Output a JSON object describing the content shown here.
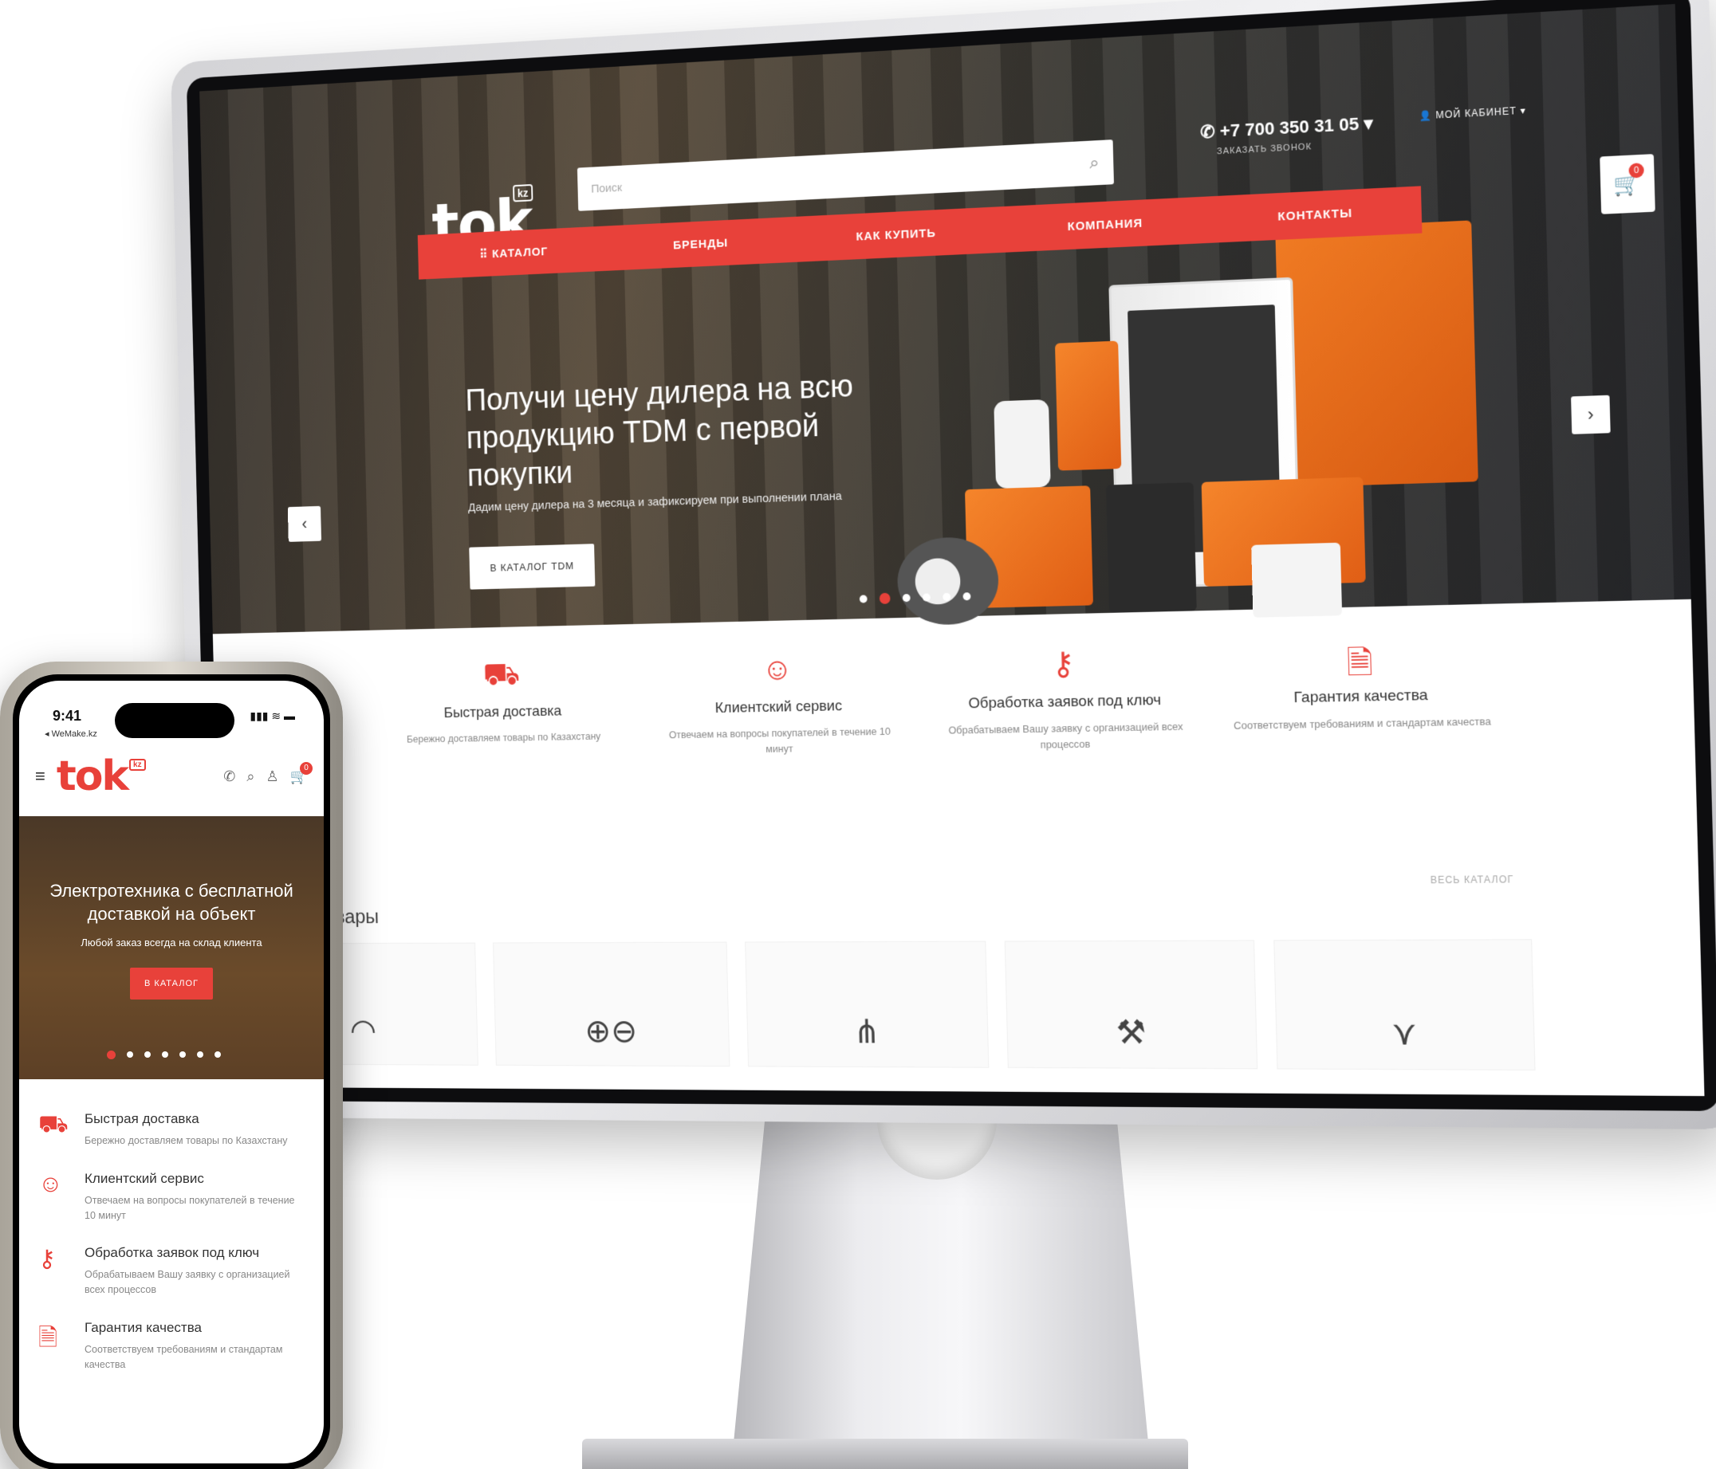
{
  "desktop": {
    "logo": "tok",
    "logo_badge": "kz",
    "search": {
      "placeholder": "Поиск"
    },
    "phone": "+7 700 350 31 05",
    "callback": "ЗАКАЗАТЬ ЗВОНОК",
    "cabinet": "МОЙ КАБИНЕТ",
    "cart_count": "0",
    "nav": [
      "КАТАЛОГ",
      "БРЕНДЫ",
      "КАК КУПИТЬ",
      "КОМПАНИЯ",
      "КОНТАКТЫ"
    ],
    "hero": {
      "title": "Получи цену дилера на всю продукцию TDM с первой покупки",
      "subtitle": "Дадим цену дилера на 3 месяца и зафиксируем при выполнении плана",
      "cta": "В КАТАЛОГ TDM"
    },
    "features": [
      {
        "icon": "delivery-truck-icon",
        "title": "Быстрая доставка",
        "desc": "Бережно доставляем товары по Казахстану"
      },
      {
        "icon": "support-agent-icon",
        "title": "Клиентский сервис",
        "desc": "Отвечаем на вопросы покупателей в течение 10 минут"
      },
      {
        "icon": "keys-icon",
        "title": "Обработка заявок под ключ",
        "desc": "Обрабатываем Вашу заявку с организацией всех процессов"
      },
      {
        "icon": "certificate-icon",
        "title": "Гарантия качества",
        "desc": "Соответствуем требованиям и стандартам качества"
      }
    ],
    "goods_title": "Наши товары",
    "all_catalog": "ВЕСЬ КАТАЛОГ"
  },
  "mobile": {
    "time": "9:41",
    "back": "◂ WeMake.kz",
    "logo": "tok",
    "logo_badge": "kz",
    "cart_count": "0",
    "hero": {
      "title": "Электротехника с бесплатной доставкой на объект",
      "subtitle": "Любой заказ всегда на склад клиента",
      "cta": "В КАТАЛОГ"
    },
    "features": [
      {
        "title": "Быстрая доставка",
        "desc": "Бережно доставляем товары по Казахстану"
      },
      {
        "title": "Клиентский сервис",
        "desc": "Отвечаем на вопросы покупателей в течение 10 минут"
      },
      {
        "title": "Обработка заявок под ключ",
        "desc": "Обрабатываем Вашу заявку с организацией всех процессов"
      },
      {
        "title": "Гарантия качества",
        "desc": "Соответствуем требованиям и стандартам качества"
      }
    ]
  },
  "colors": {
    "accent": "#e8413a",
    "hero_dark": "#2b2c30"
  }
}
